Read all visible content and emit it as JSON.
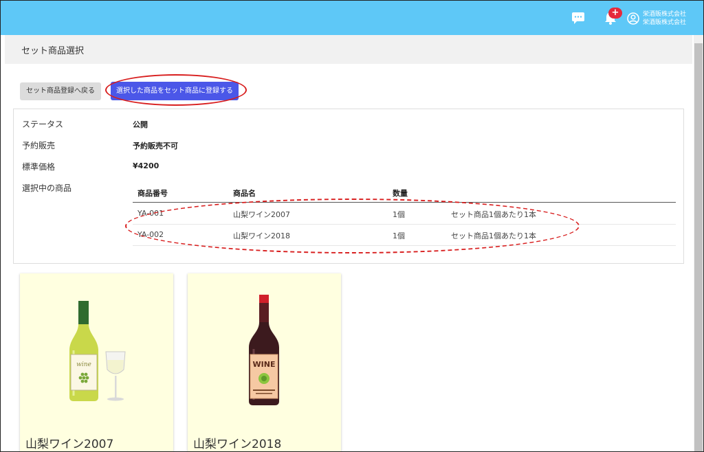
{
  "header": {
    "notification_count": "+",
    "user_line1": "栄酒販株式会社",
    "user_line2": "栄酒販株式会社",
    "bg_color": "#5ec8f7"
  },
  "page": {
    "title": "セット商品選択"
  },
  "buttons": {
    "back_label": "セット商品登録へ戻る",
    "register_label": "選択した商品をセット商品に登録する"
  },
  "info": {
    "status_label": "ステータス",
    "status_value": "公開",
    "reservation_label": "予約販売",
    "reservation_value": "予約販売不可",
    "price_label": "標準価格",
    "price_value": "¥4200",
    "selected_label": "選択中の商品"
  },
  "selected_table": {
    "headers": [
      "商品番号",
      "商品名",
      "数量"
    ],
    "rows": [
      {
        "code": "YA-001",
        "name": "山梨ワイン2007",
        "qty": "1個",
        "note": "セット商品1個あたり1本"
      },
      {
        "code": "YA-002",
        "name": "山梨ワイン2018",
        "qty": "1個",
        "note": "セット商品1個あたり1本"
      }
    ]
  },
  "products": [
    {
      "name": "山梨ワイン2007",
      "image": "white-wine-bottle-with-glass"
    },
    {
      "name": "山梨ワイン2018",
      "image": "red-wine-bottle"
    }
  ],
  "colors": {
    "accent": "#4b57e8",
    "annotation": "#d81e1e",
    "card_bg": "#ffffe0"
  }
}
